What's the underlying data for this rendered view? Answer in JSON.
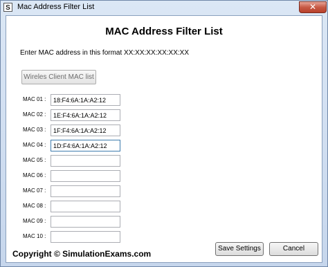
{
  "window": {
    "title": "Mac Address Filter List",
    "close_glyph": "✕"
  },
  "form": {
    "heading": "MAC Address Filter List",
    "instruction": "Enter MAC address in this format  XX:XX:XX:XX:XX:XX",
    "wireless_button": "Wireles Client MAC list",
    "entries": [
      {
        "label": "MAC 01 :",
        "value": "18:F4:6A:1A:A2:12"
      },
      {
        "label": "MAC 02 :",
        "value": "1E:F4:6A:1A:A2:12"
      },
      {
        "label": "MAC 03 :",
        "value": "1F:F4:6A:1A:A2:12"
      },
      {
        "label": "MAC 04 :",
        "value": "1D:F4:6A:1A:A2:12"
      },
      {
        "label": "MAC 05 :",
        "value": ""
      },
      {
        "label": "MAC 06 :",
        "value": ""
      },
      {
        "label": "MAC 07 :",
        "value": ""
      },
      {
        "label": "MAC 08 :",
        "value": ""
      },
      {
        "label": "MAC 09 :",
        "value": ""
      },
      {
        "label": "MAC 10 :",
        "value": ""
      }
    ]
  },
  "footer": {
    "copyright": "Copyright © SimulationExams.com",
    "save_label": "Save Settings",
    "cancel_label": "Cancel"
  }
}
